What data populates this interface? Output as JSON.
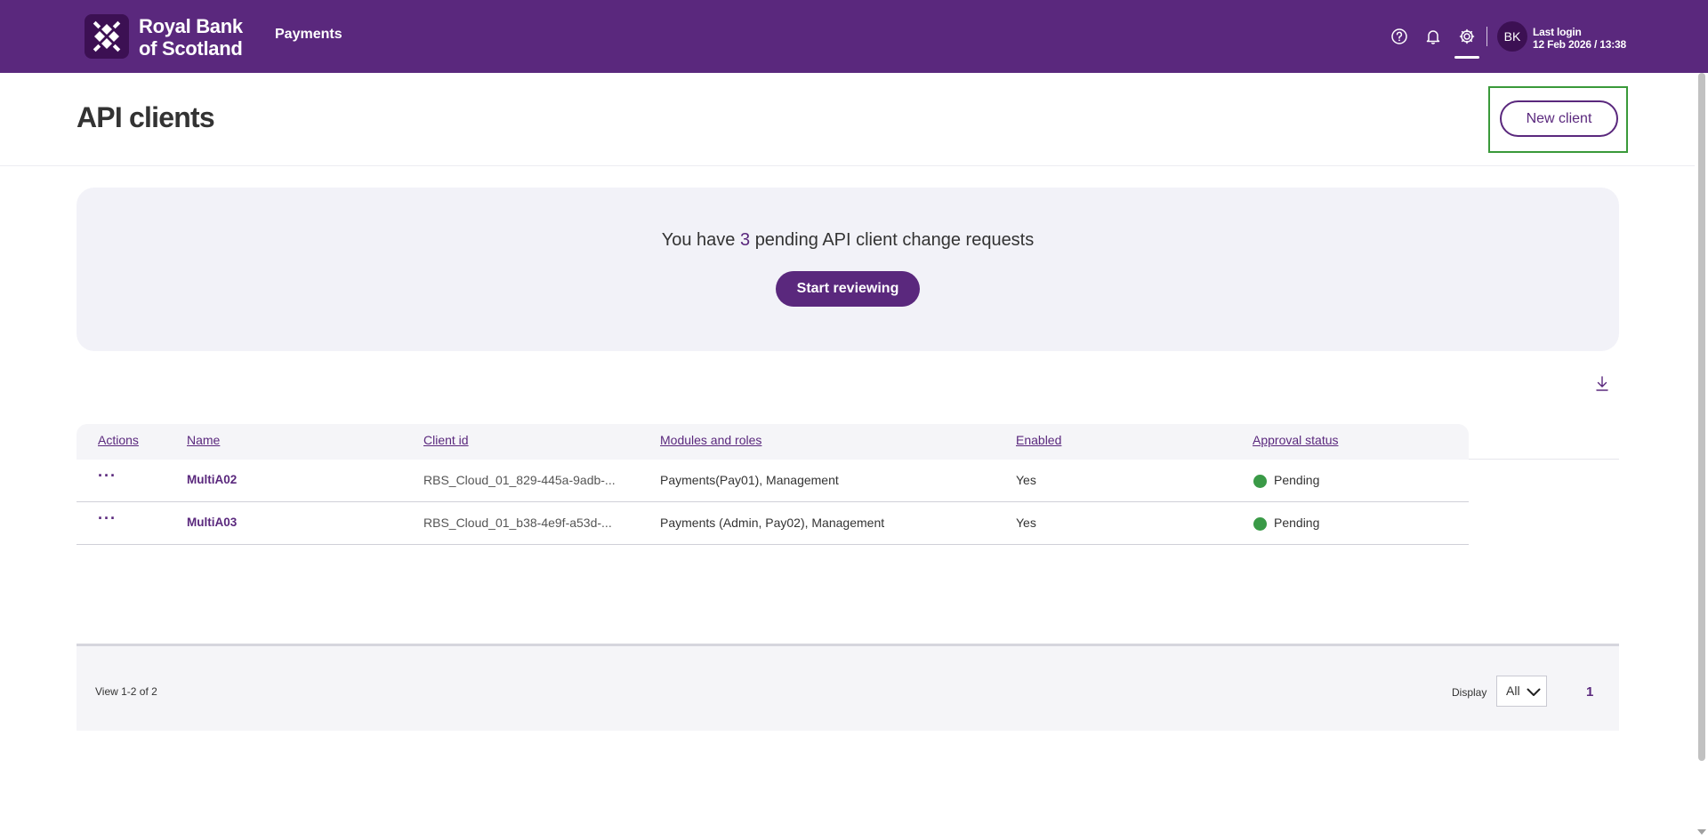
{
  "header": {
    "brand_line1": "Royal Bank",
    "brand_line2": "of Scotland",
    "nav_payments": "Payments",
    "avatar_initials": "BK",
    "last_login_label": "Last login",
    "last_login_value": "12 Feb 2026 / 13:38",
    "icons": [
      "help-icon",
      "bell-icon",
      "gear-icon"
    ]
  },
  "page": {
    "title": "API clients",
    "new_client_label": "New client"
  },
  "banner": {
    "text_before": "You have",
    "count": "3",
    "text_after": "pending API client change requests",
    "button_label": "Start reviewing"
  },
  "table": {
    "columns": [
      "Actions",
      "Name",
      "Client id",
      "Modules and roles",
      "Enabled",
      "Approval status"
    ],
    "rows": [
      {
        "actions": "···",
        "name": "MultiA02",
        "client_id": "RBS_Cloud_01_829-445a-9adb-...",
        "modules": "Payments(Pay01), Management",
        "enabled": "Yes",
        "status": "Pending",
        "status_color": "#3a9a47"
      },
      {
        "actions": "···",
        "name": "MultiA03",
        "client_id": "RBS_Cloud_01_b38-4e9f-a53d-...",
        "modules": "Payments (Admin, Pay02), Management",
        "enabled": "Yes",
        "status": "Pending",
        "status_color": "#3a9a47"
      }
    ]
  },
  "footer": {
    "view_count": "View 1-2 of 2",
    "display_label": "Display",
    "display_value": "All",
    "page_number": "1"
  },
  "colors": {
    "brand_purple": "#5a287d",
    "dark_purple": "#3c1053",
    "status_green": "#3a9a47",
    "highlight_green": "#3a9a3a"
  }
}
